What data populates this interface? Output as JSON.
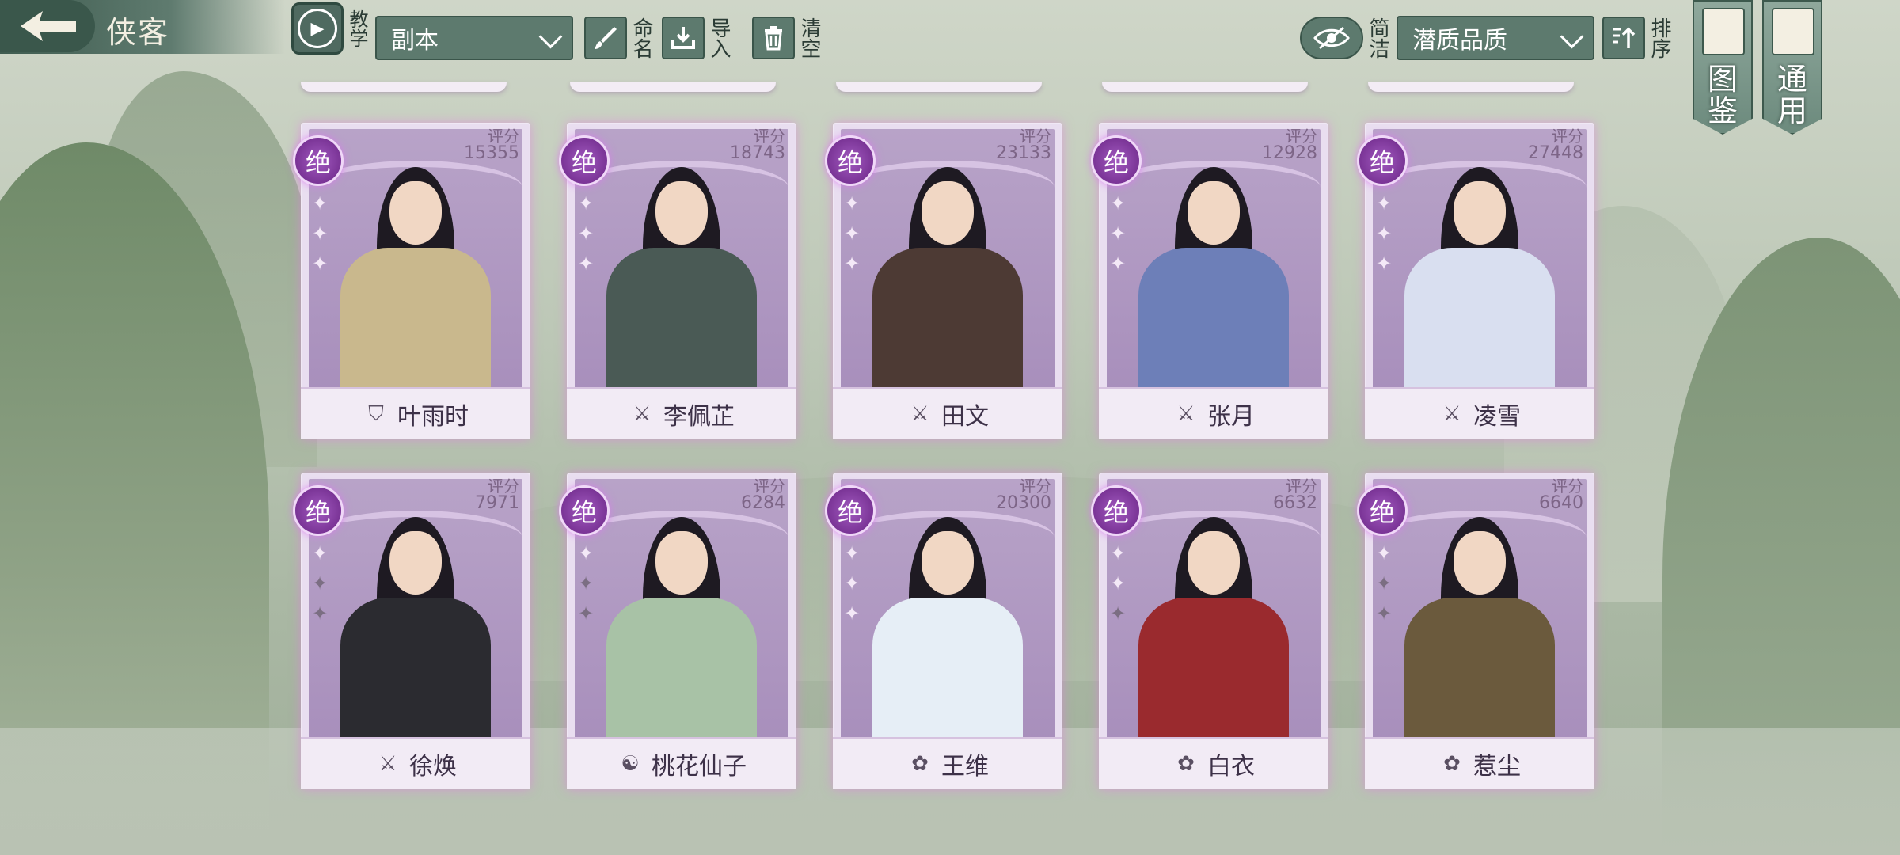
{
  "header": {
    "title": "侠客",
    "teach_label": "教学",
    "filter_select": "副本",
    "naming_label": "命名",
    "import_label": "导入",
    "clear_label": "清空",
    "simple_label": "简洁",
    "quality_select": "潜质品质",
    "sort_label": "排序",
    "atlas_label": "图鉴",
    "general_label": "通用"
  },
  "score_label": "评分",
  "cards": [
    {
      "name": "叶雨时",
      "score": "15355",
      "grade": "绝",
      "class_icon": "shield-icon",
      "stars": 3,
      "row": 0
    },
    {
      "name": "李佩芷",
      "score": "18743",
      "grade": "绝",
      "class_icon": "sword-icon",
      "stars": 3,
      "row": 0
    },
    {
      "name": "田文",
      "score": "23133",
      "grade": "绝",
      "class_icon": "sword-icon",
      "stars": 3,
      "row": 0
    },
    {
      "name": "张月",
      "score": "12928",
      "grade": "绝",
      "class_icon": "sword-icon",
      "stars": 3,
      "row": 0
    },
    {
      "name": "凌雪",
      "score": "27448",
      "grade": "绝",
      "class_icon": "sword-icon",
      "stars": 3,
      "row": 0
    },
    {
      "name": "徐焕",
      "score": "7971",
      "grade": "绝",
      "class_icon": "sword-icon",
      "stars": 1,
      "row": 1
    },
    {
      "name": "桃花仙子",
      "score": "6284",
      "grade": "绝",
      "class_icon": "yin-yang-icon",
      "stars": 1,
      "row": 1
    },
    {
      "name": "王维",
      "score": "20300",
      "grade": "绝",
      "class_icon": "lotus-icon",
      "stars": 3,
      "row": 1
    },
    {
      "name": "白衣",
      "score": "6632",
      "grade": "绝",
      "class_icon": "lotus-icon",
      "stars": 2,
      "row": 1
    },
    {
      "name": "惹尘",
      "score": "6640",
      "grade": "绝",
      "class_icon": "lotus-icon",
      "stars": 1,
      "row": 1
    }
  ],
  "colors": {
    "accent": "#5d7a6e",
    "card_frame": "#e9def0",
    "grade_badge": "#8a3fa8",
    "text_dark": "#3d3148"
  }
}
